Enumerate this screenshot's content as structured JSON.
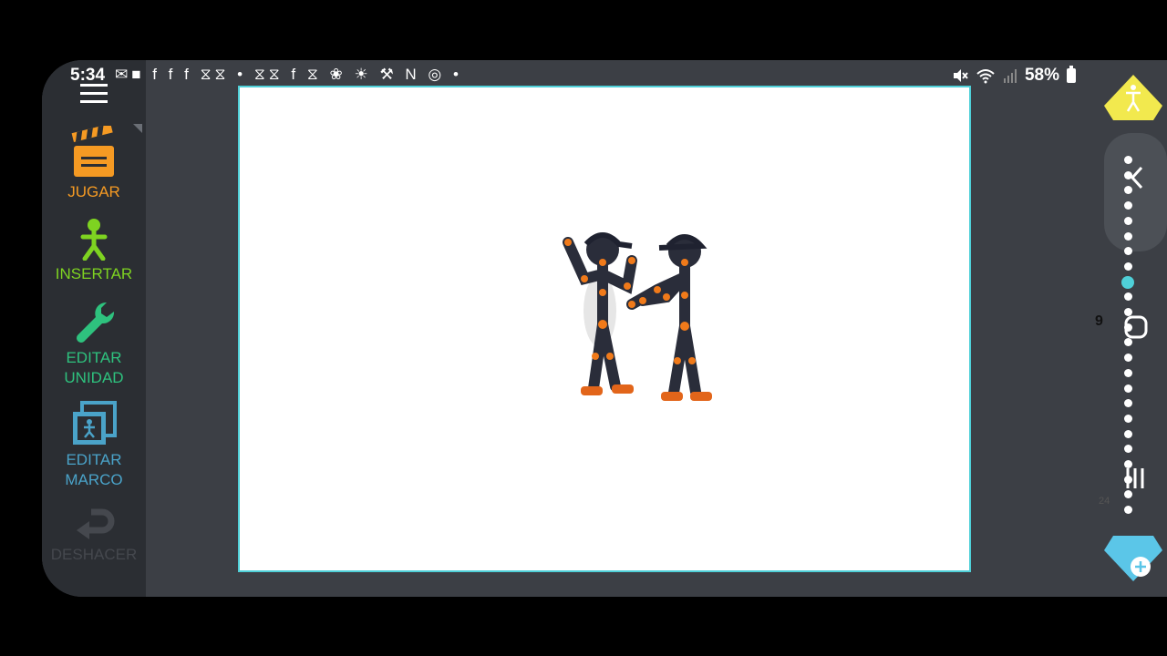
{
  "status": {
    "time": "5:34",
    "icons": "✉■ f f f ⧖⧖ • ⧖⧖ f ⧖ ❀ ☀ ⚒ N ◎ •",
    "battery": "58%"
  },
  "tools": {
    "play": {
      "label": "JUGAR",
      "icon": "clapperboard-icon"
    },
    "insert": {
      "label": "INSERTAR",
      "icon": "stickman-icon"
    },
    "edit_unit": {
      "label_line1": "EDITAR",
      "label_line2": "UNIDAD",
      "icon": "wrench-icon"
    },
    "edit_frame": {
      "label_line1": "EDITAR",
      "label_line2": "MARCO",
      "icon": "frame-icon"
    },
    "undo": {
      "label": "DESHACER",
      "icon": "undo-icon"
    }
  },
  "timeline": {
    "current_frame": "9",
    "total_frames": "24"
  },
  "colors": {
    "accent": "#4fd0d8",
    "play": "#f59a23",
    "insert": "#7ed321",
    "edit_unit": "#2ec27e",
    "edit_frame": "#4aa3c9"
  }
}
